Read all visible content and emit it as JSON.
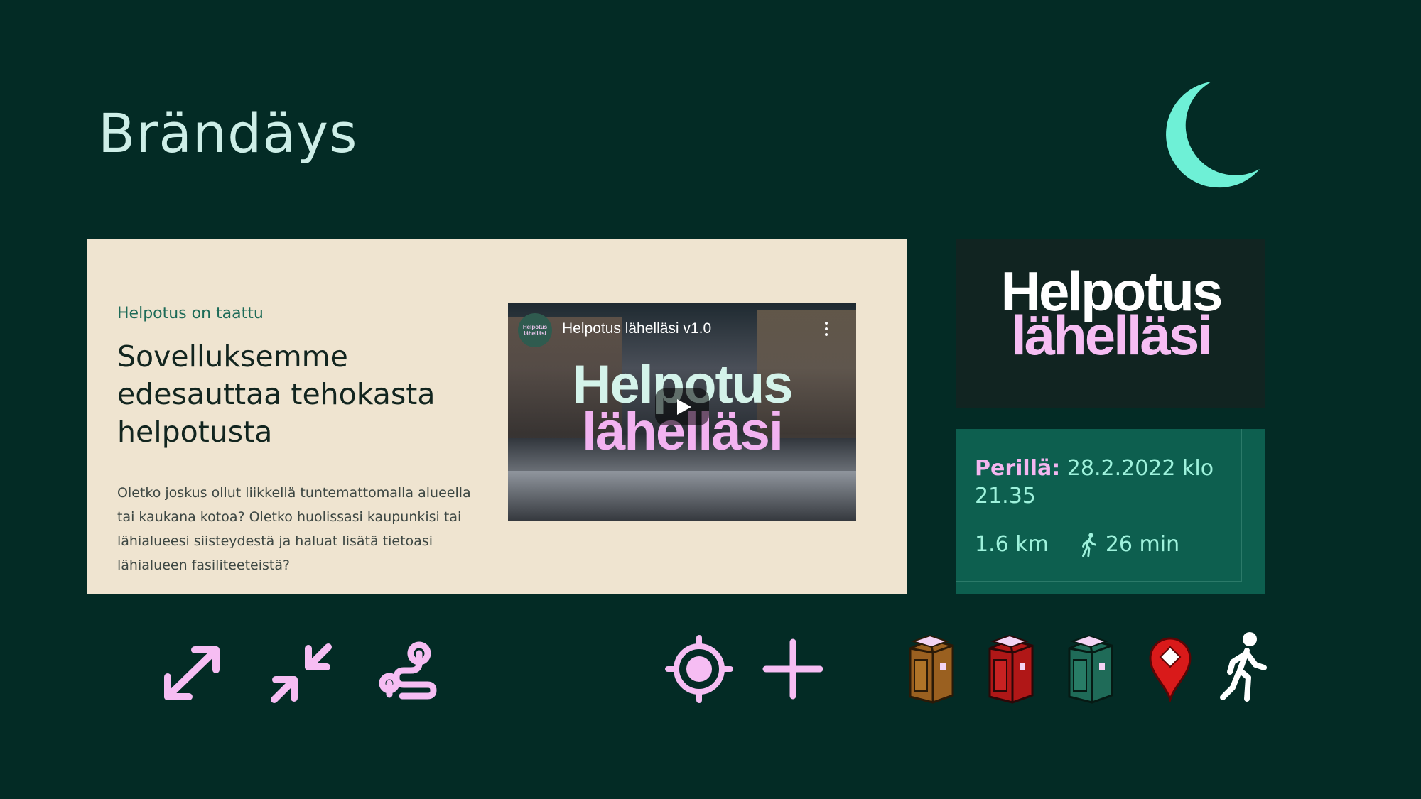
{
  "slide": {
    "title": "Brändäys"
  },
  "landing": {
    "eyebrow": "Helpotus on taattu",
    "headline": "Sovelluksemme edesauttaa tehokasta helpotusta",
    "body": "Oletko joskus ollut liikkellä tuntemattomalla alueella tai kaukana kotoa? Oletko huolissasi kaupunkisi tai lähialueesi siisteydestä ja haluat lisätä tietoasi lähialueen fasiliteeteistä?",
    "video": {
      "title": "Helpotus lähelläsi v1.0",
      "channel_badge": "Helpotus lähelläsi",
      "logo_line1": "Helpotus",
      "logo_line2": "lähelläsi"
    }
  },
  "brand_logo": {
    "line1": "Helpotus",
    "line2": "lähelläsi"
  },
  "arrival_card": {
    "label": "Perillä:",
    "value": "28.2.2022 klo 21.35",
    "distance": "1.6 km",
    "duration": "26 min"
  },
  "icons": [
    "expand-icon",
    "collapse-icon",
    "route-icon",
    "locate-icon",
    "plus-icon",
    "toilet-brown-icon",
    "toilet-red-icon",
    "toilet-green-icon",
    "map-pin-icon",
    "walking-person-icon"
  ],
  "colors": {
    "background": "#032b25",
    "accent_pink": "#f6bdf3",
    "accent_mint": "#7ef0d8",
    "card_cream": "#efe4d0",
    "card_teal": "#0d5f4f"
  }
}
